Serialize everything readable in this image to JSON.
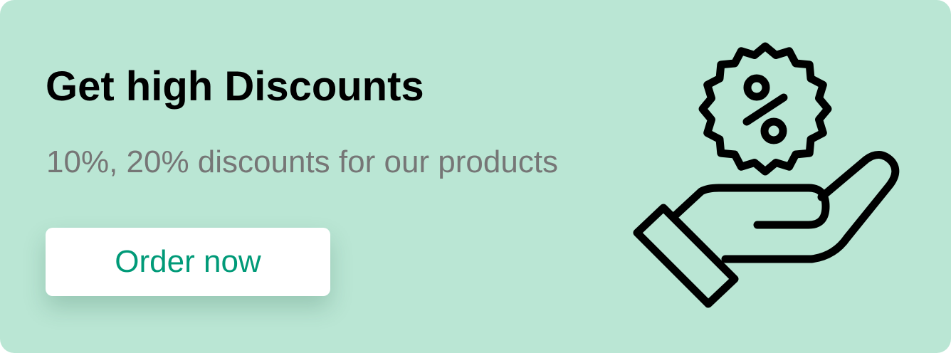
{
  "banner": {
    "title": "Get high Discounts",
    "subtitle": "10%, 20% discounts for our products",
    "cta_label": "Order now",
    "illustration": {
      "icon": "hand-holding-discount-badge-icon",
      "badge_symbol": "%"
    },
    "colors": {
      "background": "#bae6d4",
      "title": "#000000",
      "subtitle": "#767676",
      "cta_text": "#009a78",
      "cta_background": "#ffffff",
      "icon_stroke": "#000000"
    }
  }
}
